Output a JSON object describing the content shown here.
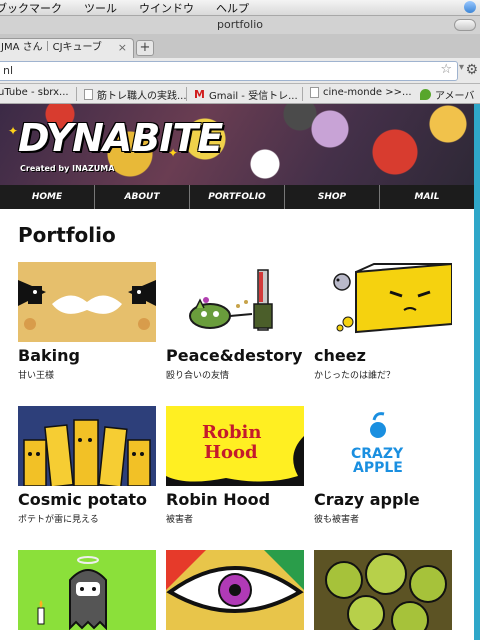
{
  "os_menu": {
    "items": [
      "ブックマーク",
      "ツール",
      "ウインドウ",
      "ヘルプ"
    ]
  },
  "window": {
    "title": "portfolio"
  },
  "tab": {
    "label": "JMA さん｜CJキューブ",
    "close": "×",
    "new": "+"
  },
  "address": {
    "url": "nl"
  },
  "bookmarks": [
    {
      "label": "uTube - sbrx...",
      "icon": "youtube-icon"
    },
    {
      "label": "筋トレ職人の実践...",
      "icon": "page-icon"
    },
    {
      "label": "Gmail - 受信トレ...",
      "icon": "gmail-icon"
    },
    {
      "label": "cine-monde >>...",
      "icon": "page-icon"
    },
    {
      "label": "アメーバ",
      "icon": "ameba-icon"
    }
  ],
  "site": {
    "logo": "DYNABITE",
    "tagline": "Created by INAZUMA",
    "nav": [
      "HOME",
      "ABOUT",
      "PORTFOLIO",
      "SHOP",
      "MAIL"
    ],
    "page_title": "Portfolio"
  },
  "portfolio": [
    {
      "title": "Baking",
      "subtitle": "甘い王様"
    },
    {
      "title": "Peace&destory",
      "subtitle": "殴り合いの友情"
    },
    {
      "title": "cheez",
      "subtitle": "かじったのは誰だ？"
    },
    {
      "title": "Cosmic potato",
      "subtitle": "ポテトが雷に見える"
    },
    {
      "title": "Robin Hood",
      "subtitle": "被害者"
    },
    {
      "title": "Crazy apple",
      "subtitle": "彼も被害者"
    },
    {
      "title": "",
      "subtitle": ""
    },
    {
      "title": "",
      "subtitle": ""
    },
    {
      "title": "",
      "subtitle": ""
    }
  ],
  "thumb_text": {
    "robin": [
      "Robin",
      "Hood"
    ],
    "apple": [
      "CRAZY",
      "APPLE"
    ]
  },
  "colors": {
    "nav_bg": "#1c1c1c",
    "accent_edge": "#2fa7c9",
    "baking_bg": "#e6bf6c",
    "cheez_bg": "#f5d20f",
    "robin_bg": "#ffef22"
  }
}
